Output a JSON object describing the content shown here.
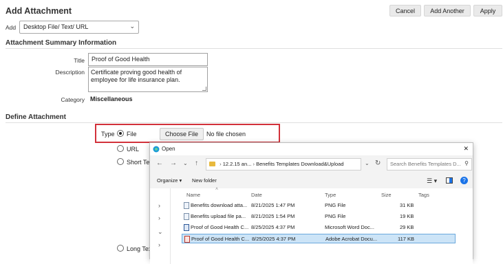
{
  "header": {
    "title": "Add Attachment",
    "cancel_label": "Cancel",
    "add_another_label": "Add Another",
    "apply_label": "Apply"
  },
  "add_field": {
    "label": "Add",
    "value": "Desktop File/ Text/ URL"
  },
  "summary": {
    "section_title": "Attachment Summary Information",
    "title_label": "Title",
    "title_value": "Proof of Good Health",
    "description_label": "Description",
    "description_value": "Certificate proving good health of employee for life insurance plan.",
    "category_label": "Category",
    "category_value": "Miscellaneous"
  },
  "define": {
    "section_title": "Define Attachment",
    "type_label": "Type",
    "options": [
      "File",
      "URL",
      "Short Te",
      "Long Tex"
    ],
    "selected": "File",
    "choose_file_label": "Choose File",
    "no_file_text": "No file chosen"
  },
  "open_dialog": {
    "title": "Open",
    "close_glyph": "✕",
    "path": [
      "12.2.15 an...",
      "Benefits Templates Download&Upload"
    ],
    "search_placeholder": "Search Benefits Templates D...",
    "organize_label": "Organize",
    "new_folder_label": "New folder",
    "columns": [
      "Name",
      "Date",
      "Type",
      "Size",
      "Tags"
    ],
    "files": [
      {
        "name": "Benefits download atta...",
        "date": "8/21/2025 1:47 PM",
        "type": "PNG File",
        "size": "31 KB",
        "icon": "image-file-icon"
      },
      {
        "name": "Benefits upload file pa...",
        "date": "8/21/2025 1:54 PM",
        "type": "PNG File",
        "size": "19 KB",
        "icon": "image-file-icon"
      },
      {
        "name": "Proof of Good Health C...",
        "date": "8/25/2025 4:37 PM",
        "type": "Microsoft Word Doc...",
        "size": "29 KB",
        "icon": "word-file-icon"
      },
      {
        "name": "Proof of Good Health C...",
        "date": "8/25/2025 4:37 PM",
        "type": "Adobe Acrobat Docu...",
        "size": "117 KB",
        "icon": "pdf-file-icon"
      }
    ],
    "selected_row": 3
  },
  "colors": {
    "highlight_border": "#d2313a",
    "selected_row": "#cce4f7",
    "accent": "#1a73e8"
  }
}
